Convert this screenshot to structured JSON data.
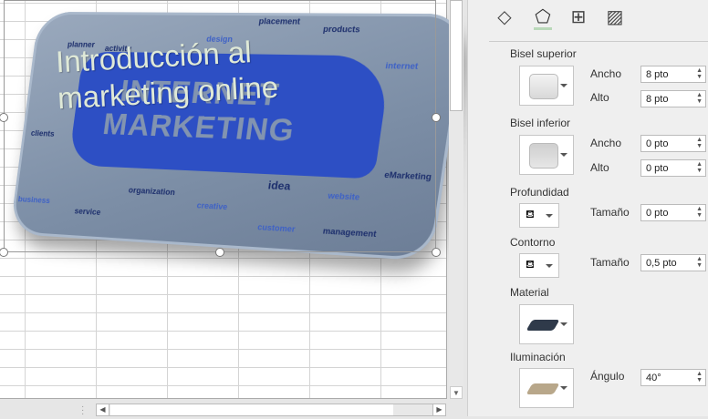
{
  "picture": {
    "title_line1": "Introducción al",
    "title_line2": "marketing online",
    "big_words": [
      "INTERNET",
      "MARKETING"
    ],
    "words": [
      "placement",
      "products",
      "design",
      "planner",
      "activity",
      "internet",
      "clients",
      "eMarketing",
      "idea",
      "website",
      "organization",
      "creative",
      "business",
      "service",
      "customer",
      "management"
    ]
  },
  "panel": {
    "tabs": [
      "fill-line-icon",
      "effects-icon",
      "size-properties-icon",
      "picture-icon"
    ],
    "bisel_superior": {
      "label": "Bisel superior",
      "ancho_label": "Ancho",
      "ancho": "8 pto",
      "alto_label": "Alto",
      "alto": "8 pto"
    },
    "bisel_inferior": {
      "label": "Bisel inferior",
      "ancho_label": "Ancho",
      "ancho": "0 pto",
      "alto_label": "Alto",
      "alto": "0 pto"
    },
    "profundidad": {
      "label": "Profundidad",
      "tam_label": "Tamaño",
      "tam": "0 pto"
    },
    "contorno": {
      "label": "Contorno",
      "tam_label": "Tamaño",
      "tam": "0,5 pto"
    },
    "material": {
      "label": "Material"
    },
    "iluminacion": {
      "label": "Iluminación",
      "angulo_label": "Ángulo",
      "angulo": "40°"
    }
  }
}
